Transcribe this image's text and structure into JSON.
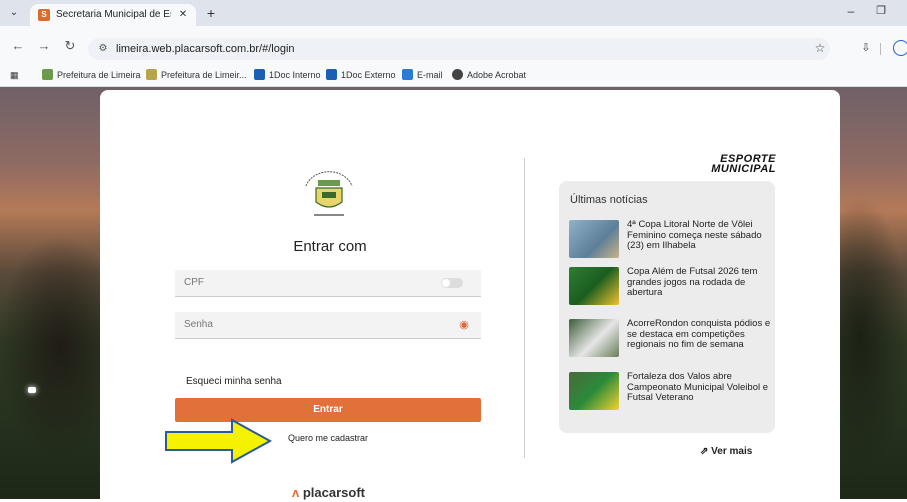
{
  "browser": {
    "tab_title": "Secretaria Municipal de Esporte",
    "url": "limeira.web.placarsoft.com.br/#/login",
    "bookmarks": [
      "Prefeitura de Limeira",
      "Prefeitura de Limeir...",
      "1Doc Interno",
      "1Doc Externo",
      "E-mail",
      "Adobe Acrobat"
    ]
  },
  "login": {
    "title": "Entrar com",
    "cpf_placeholder": "CPF",
    "password_placeholder": "Senha",
    "forgot": "Esqueci minha senha",
    "enter_button": "Entrar",
    "signup_link": "Quero me cadastrar",
    "footer_brand": "placarsoft"
  },
  "brand": {
    "line1": "ESPORTE",
    "line2": "MUNICIPAL"
  },
  "news": {
    "title": "Últimas notícias",
    "items": [
      "4ª Copa Litoral Norte de Vôlei Feminino começa neste sábado (23) em Ilhabela",
      "Copa Além de Futsal 2026 tem grandes jogos na rodada de abertura",
      "AcorreRondon conquista pódios e se destaca em competições regionais no fim de semana",
      "Fortaleza dos Valos abre Campeonato Municipal Voleibol e Futsal Veterano"
    ],
    "more": "Ver mais"
  },
  "colors": {
    "accent": "#e2703a",
    "arrow": "#f5f200"
  }
}
